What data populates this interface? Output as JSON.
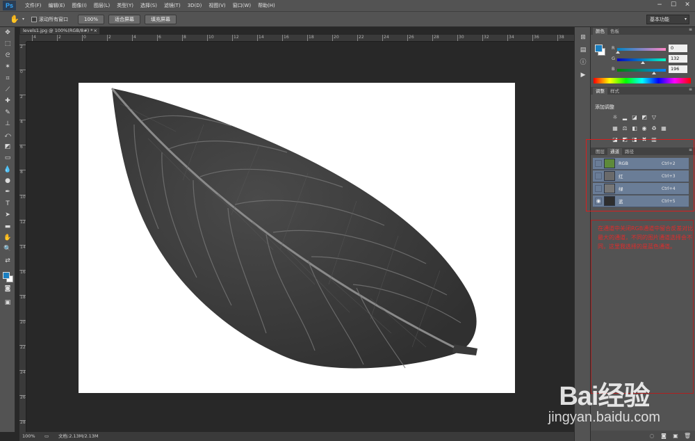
{
  "app": {
    "logo": "Ps"
  },
  "menu": [
    "文件(F)",
    "编辑(E)",
    "图像(I)",
    "图层(L)",
    "类型(Y)",
    "选择(S)",
    "滤镜(T)",
    "3D(D)",
    "视图(V)",
    "窗口(W)",
    "帮助(H)"
  ],
  "window_controls": [
    "−",
    "☐",
    "✕"
  ],
  "options": {
    "scroll_all_label": "滚动所有窗口",
    "zoom_100": "100%",
    "fit_screen": "适合屏幕",
    "fill_screen": "填充屏幕",
    "workspace": "基本功能"
  },
  "document": {
    "tab_title": "levels1.jpg @ 100%(RGB/8#) *",
    "close": "×",
    "ruler_h": [
      "4",
      "2",
      "0",
      "2",
      "4",
      "6",
      "8",
      "10",
      "12",
      "14",
      "16",
      "18",
      "20",
      "22",
      "24",
      "26",
      "28",
      "30",
      "32",
      "34",
      "36",
      "38"
    ],
    "ruler_v": [
      "2",
      "0",
      "2",
      "4",
      "6",
      "8",
      "10",
      "12",
      "14",
      "16",
      "18",
      "20",
      "22",
      "24",
      "26",
      "28"
    ]
  },
  "status": {
    "zoom": "100%",
    "doc_info": "文档:2.13M/2.13M"
  },
  "color_panel": {
    "tabs": [
      "颜色",
      "色板"
    ],
    "fg_color": "#1a7fc1",
    "bg_color": "#ffffff",
    "r_label": "R",
    "r_value": "0",
    "g_label": "G",
    "g_value": "132",
    "b_label": "B",
    "b_value": "196"
  },
  "adjust_panel": {
    "tabs": [
      "调整",
      "样式"
    ],
    "title": "添加调整"
  },
  "channels_panel": {
    "tabs": [
      "图层",
      "通道",
      "路径"
    ],
    "channels": [
      {
        "name": "RGB",
        "shortcut": "Ctrl+2",
        "thumb": "#5e8a3a",
        "visible": false
      },
      {
        "name": "红",
        "shortcut": "Ctrl+3",
        "thumb": "#6a6a6a",
        "visible": false
      },
      {
        "name": "绿",
        "shortcut": "Ctrl+4",
        "thumb": "#777777",
        "visible": false
      },
      {
        "name": "蓝",
        "shortcut": "Ctrl+5",
        "thumb": "#2e2e2e",
        "visible": true
      }
    ]
  },
  "annotation": "在通道中关闭RGB通道中留合反差对比最大的通道，不同的图片通道选择会不同，这里我选择的是蓝色通道。",
  "watermark": {
    "logo_text": "Bai经验",
    "url": "jingyan.baidu.com"
  },
  "accent": "#1a7fc1"
}
